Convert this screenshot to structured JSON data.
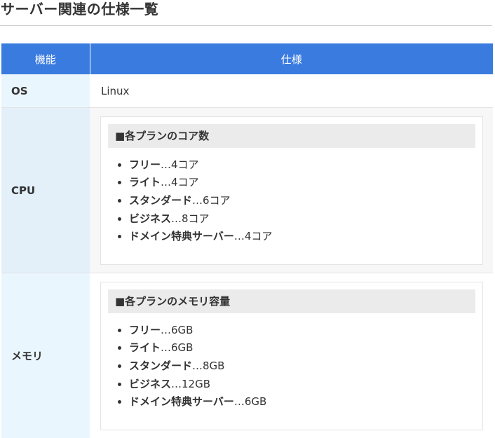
{
  "page_title": "サーバー関連の仕様一覧",
  "table": {
    "headers": [
      "機能",
      "仕様"
    ],
    "os": {
      "label": "OS",
      "value": "Linux"
    },
    "cpu": {
      "label": "CPU",
      "box_title": "■各プランのコア数",
      "items": [
        {
          "plan": "フリー",
          "value": "…4コア"
        },
        {
          "plan": "ライト",
          "value": "…4コア"
        },
        {
          "plan": "スタンダード",
          "value": "…6コア"
        },
        {
          "plan": "ビジネス",
          "value": "…8コア"
        },
        {
          "plan": "ドメイン特典サーバー",
          "value": "…4コア"
        }
      ]
    },
    "memory": {
      "label": "メモリ",
      "box_title": "■各プランのメモリ容量",
      "items": [
        {
          "plan": "フリー",
          "value": "…6GB"
        },
        {
          "plan": "ライト",
          "value": "…6GB"
        },
        {
          "plan": "スタンダード",
          "value": "…8GB"
        },
        {
          "plan": "ビジネス",
          "value": "…12GB"
        },
        {
          "plan": "ドメイン特典サーバー",
          "value": "…6GB"
        }
      ]
    }
  },
  "colors": {
    "header_bg": "#3a7be0",
    "feature_cell_bg": "#eaf6fe",
    "box_title_bg": "#ebebeb"
  }
}
